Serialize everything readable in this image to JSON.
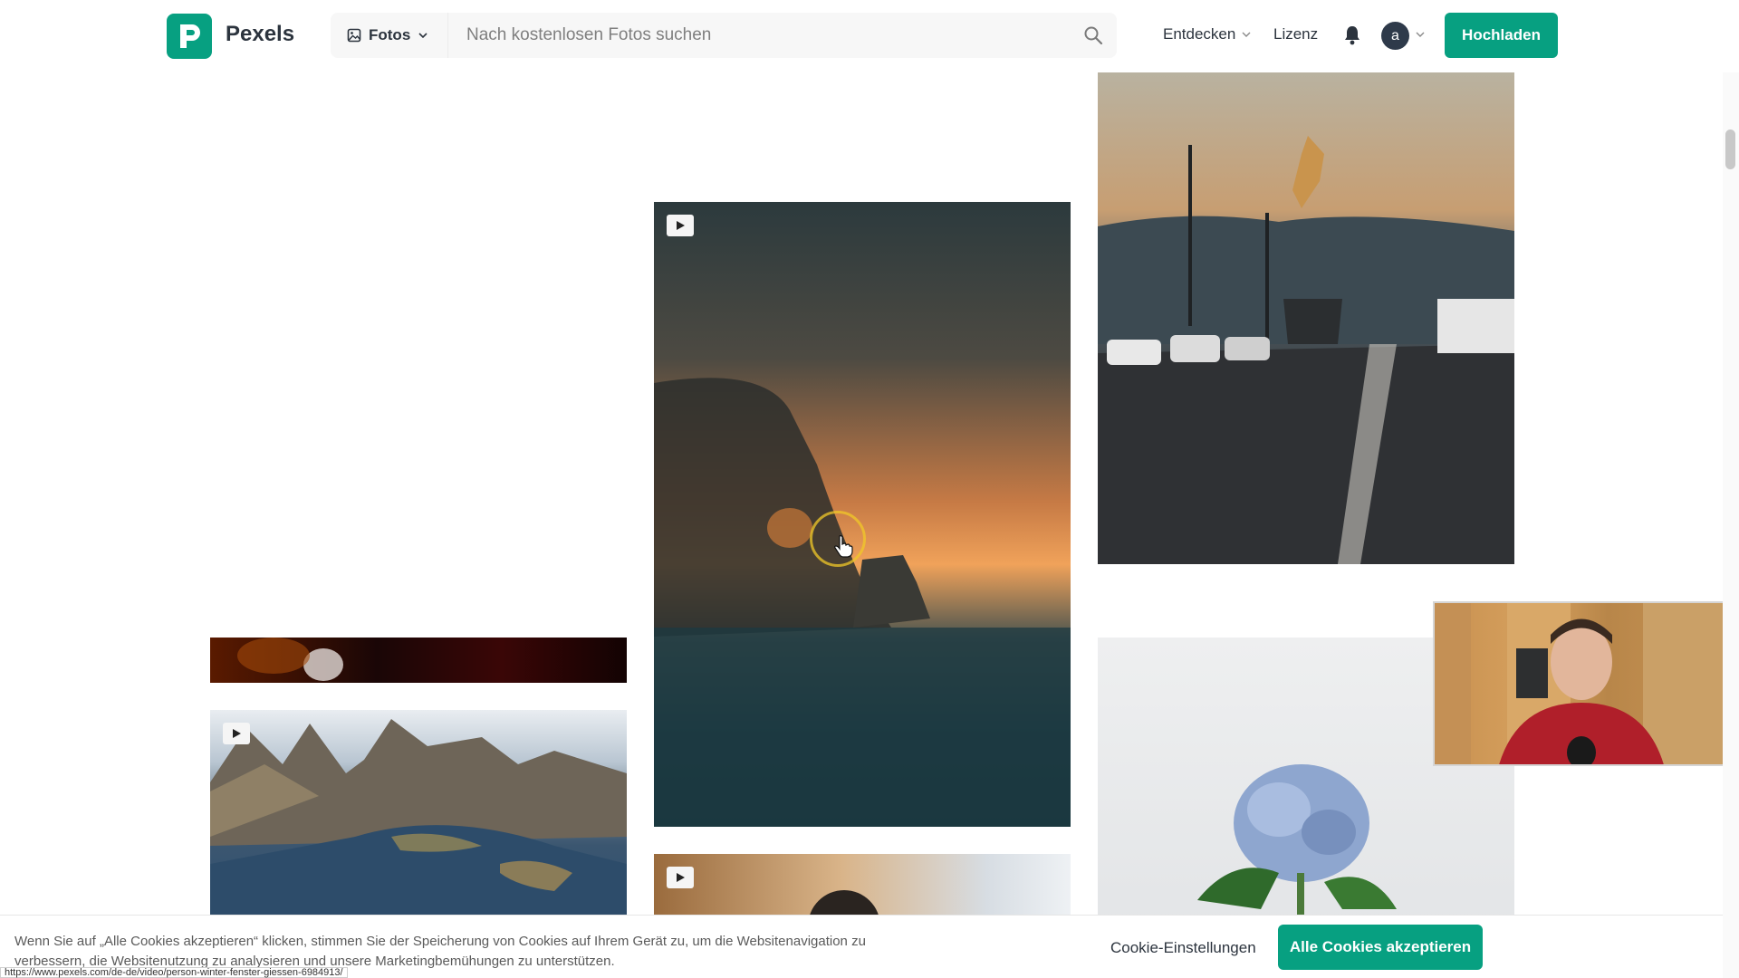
{
  "header": {
    "brand": "Pexels",
    "media_type": "Fotos",
    "search_placeholder": "Nach kostenlosen Fotos suchen",
    "nav_explore": "Entdecken",
    "nav_license": "Lizenz",
    "avatar_letter": "a",
    "upload_label": "Hochladen"
  },
  "gallery": {
    "tiles": [
      {
        "name": "dark-red-photo",
        "is_video": false
      },
      {
        "name": "lofoten-islands-video",
        "is_video": true
      },
      {
        "name": "sea-cliff-sunset-video",
        "is_video": true
      },
      {
        "name": "person-at-window-video",
        "is_video": true
      },
      {
        "name": "statue-street-photo",
        "is_video": false
      },
      {
        "name": "hydrangea-photo",
        "is_video": false
      }
    ]
  },
  "cookie_banner": {
    "text": "Wenn Sie auf „Alle Cookies akzeptieren“ klicken, stimmen Sie der Speicherung von Cookies auf Ihrem Gerät zu, um die Websitenavigation zu verbessern, die Websitenutzung zu analysieren und unsere Marketingbemühungen zu unterstützen.",
    "settings_label": "Cookie-Einstellungen",
    "accept_label": "Alle Cookies akzeptieren"
  },
  "status_bar": {
    "url": "https://www.pexels.com/de-de/video/person-winter-fenster-giessen-6984913/"
  },
  "colors": {
    "brand_green": "#07a081",
    "text_dark": "#2c343e"
  }
}
